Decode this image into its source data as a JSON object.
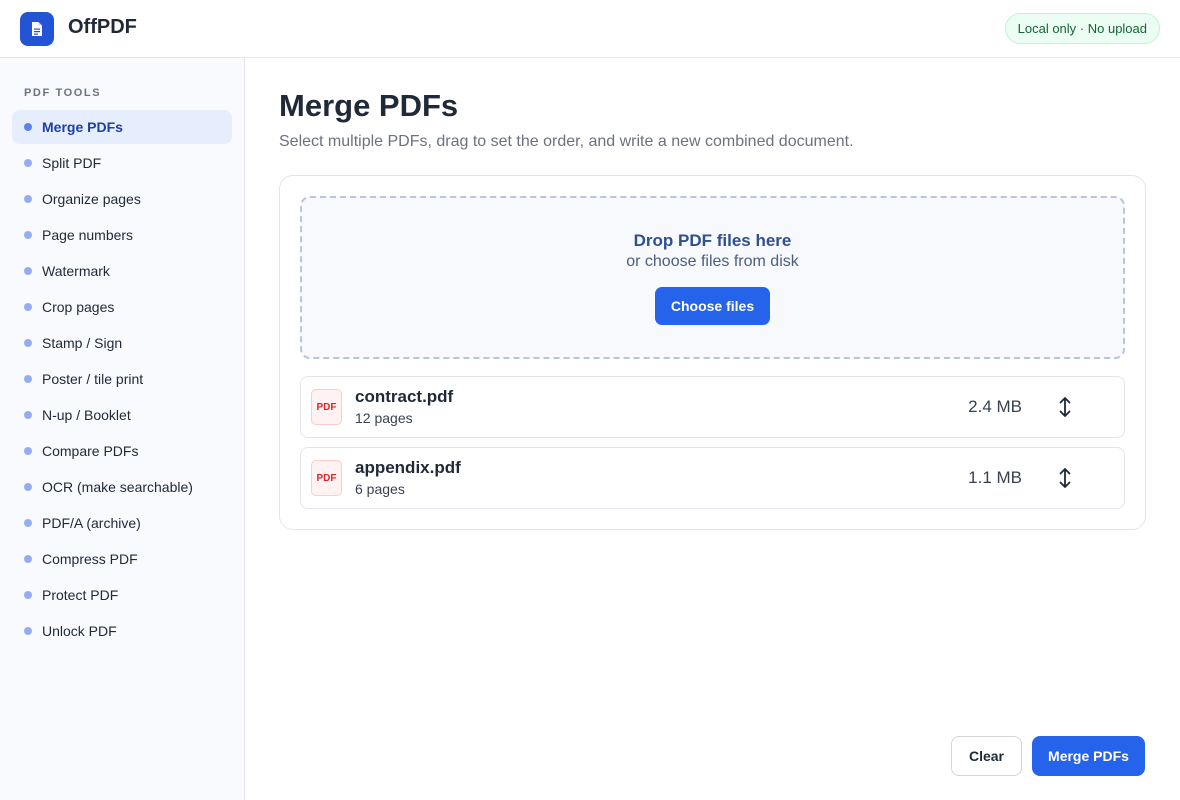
{
  "app": {
    "title": "OffPDF",
    "badge": "Local only · No upload",
    "logo_icon": "document-icon",
    "accent": "#2563eb"
  },
  "sidebar": {
    "heading": "PDF TOOLS",
    "items": [
      {
        "label": "Merge PDFs",
        "active": true
      },
      {
        "label": "Split PDF"
      },
      {
        "label": "Organize pages"
      },
      {
        "label": "Page numbers"
      },
      {
        "label": "Watermark"
      },
      {
        "label": "Crop pages"
      },
      {
        "label": "Stamp / Sign"
      },
      {
        "label": "Poster / tile print"
      },
      {
        "label": "N-up / Booklet"
      },
      {
        "label": "Compare PDFs"
      },
      {
        "label": "OCR (make searchable)"
      },
      {
        "label": "PDF/A (archive)"
      },
      {
        "label": "Compress PDF"
      },
      {
        "label": "Protect PDF"
      },
      {
        "label": "Unlock PDF"
      }
    ]
  },
  "main": {
    "title": "Merge PDFs",
    "subtitle": "Select multiple PDFs, drag to set the order, and write a new combined document.",
    "dropzone": {
      "title": "Drop PDF files here",
      "subtitle": "or choose files from disk",
      "button_label": "Choose files"
    },
    "files": [
      {
        "icon_label": "PDF",
        "name": "contract.pdf",
        "pages": "12 pages",
        "size": "2.4 MB"
      },
      {
        "icon_label": "PDF",
        "name": "appendix.pdf",
        "pages": "6 pages",
        "size": "1.1 MB"
      }
    ],
    "actions": {
      "clear_label": "Clear",
      "merge_label": "Merge PDFs"
    }
  }
}
